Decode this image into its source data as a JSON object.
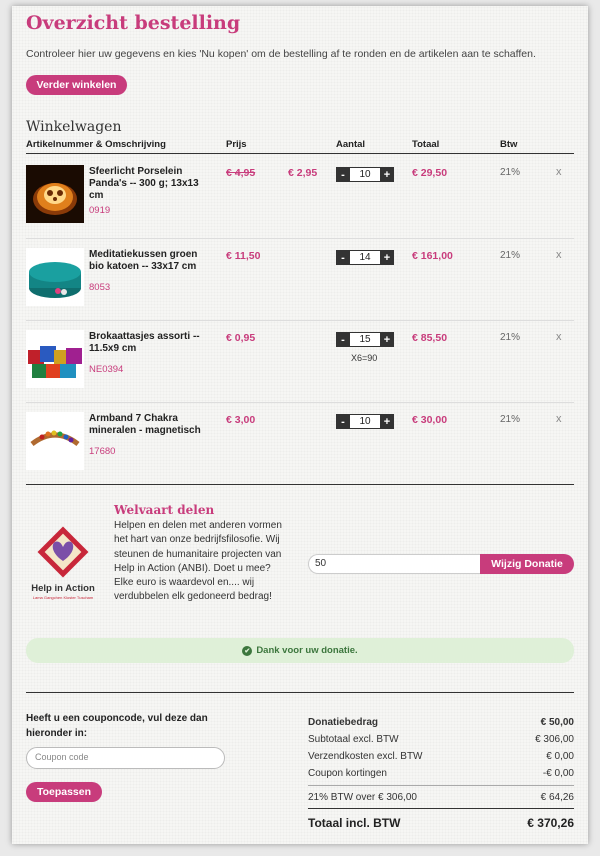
{
  "page": {
    "title": "Overzicht bestelling",
    "intro": "Controleer hier uw gegevens en kies 'Nu kopen' om de bestelling af te ronden en de artikelen aan te schaffen.",
    "continue_label": "Verder winkelen"
  },
  "cart": {
    "title": "Winkelwagen",
    "headers": {
      "article": "Artikelnummer & Omschrijving",
      "price": "Prijs",
      "quantity": "Aantal",
      "total": "Totaal",
      "vat": "Btw"
    },
    "items": [
      {
        "name": "Sfeerlicht Porselein Panda's -- 300 g; 13x13 cm",
        "code": "0919",
        "old_price": "€ 4,95",
        "price": "€ 2,95",
        "qty": "10",
        "qty_note": "",
        "total": "€ 29,50",
        "vat": "21%",
        "image_icon": "panda-lantern-image"
      },
      {
        "name": "Meditatiekussen groen bio katoen -- 33x17 cm",
        "code": "8053",
        "old_price": "",
        "price": "€ 11,50",
        "qty": "14",
        "qty_note": "",
        "total": "€ 161,00",
        "vat": "21%",
        "image_icon": "meditation-cushion-image"
      },
      {
        "name": "Brokaattasjes assorti -- 11.5x9 cm",
        "code": "NE0394",
        "old_price": "",
        "price": "€ 0,95",
        "qty": "15",
        "qty_note": "X6=90",
        "total": "€ 85,50",
        "vat": "21%",
        "image_icon": "brocade-bags-image"
      },
      {
        "name": "Armband 7 Chakra mineralen - magnetisch",
        "code": "17680",
        "old_price": "",
        "price": "€ 3,00",
        "qty": "10",
        "qty_note": "",
        "total": "€ 30,00",
        "vat": "21%",
        "image_icon": "chakra-bracelet-image"
      }
    ],
    "minus": "-",
    "plus": "+",
    "remove": "x"
  },
  "donation": {
    "title": "Welvaart delen",
    "text": "Helpen en delen met anderen vormen het hart van onze bedrijfsfilosofie. Wij steunen de humanitaire projecten van Help in Action (ANBI). Doet u mee? Elke euro is waardevol en.... wij verdubbelen elk gedoneerd bedrag!",
    "logo_text": "Help in Action",
    "logo_subtext": "Lama Gangchen Kloster Tuscham",
    "amount": "50",
    "button_label": "Wijzig Donatie",
    "thanks": "Dank voor uw donatie."
  },
  "coupon": {
    "label": "Heeft u een couponcode, vul deze dan hieronder in:",
    "placeholder": "Coupon code",
    "apply_label": "Toepassen"
  },
  "summary": {
    "donation_label": "Donatiebedrag",
    "donation_value": "€ 50,00",
    "subtotal_label": "Subtotaal excl. BTW",
    "subtotal_value": "€ 306,00",
    "shipping_label": "Verzendkosten excl. BTW",
    "shipping_value": "€ 0,00",
    "coupon_label": "Coupon kortingen",
    "coupon_value": "-€ 0,00",
    "vat_label": "21% BTW over € 306,00",
    "vat_value": "€ 64,26",
    "total_label": "Totaal incl. BTW",
    "total_value": "€ 370,26"
  },
  "colors": {
    "accent": "#c83c7c",
    "success_bg": "#dff0d8",
    "success_text": "#3c763d"
  }
}
